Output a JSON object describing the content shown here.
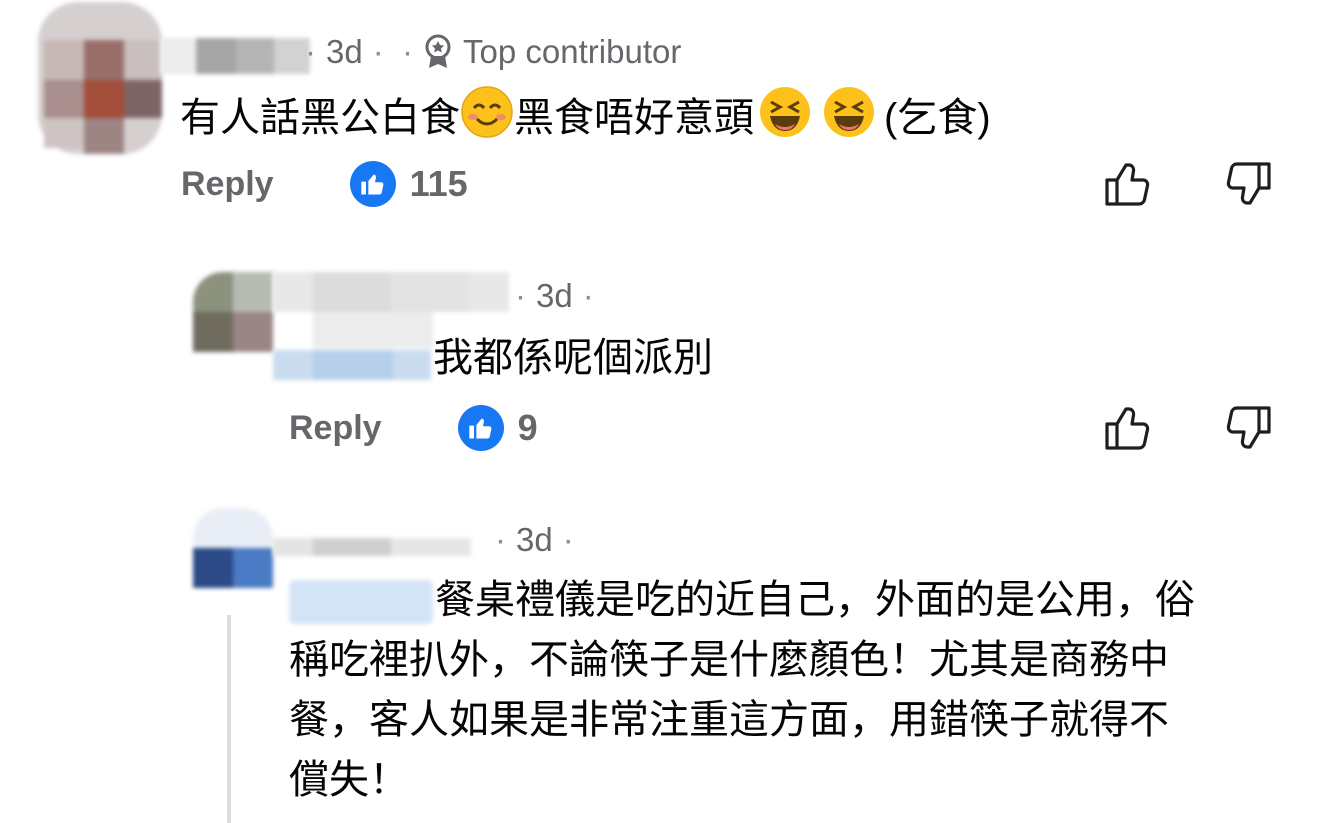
{
  "comments": [
    {
      "time": "3d",
      "badge": "Top contributor",
      "text_parts": [
        "有人話黑公白食",
        "黑食唔好意頭",
        "(乞食)"
      ],
      "reply_label": "Reply",
      "like_count": "115"
    },
    {
      "time": "3d",
      "text": "我都係呢個派別",
      "reply_label": "Reply",
      "like_count": "9"
    },
    {
      "time": "3d",
      "text_lines": [
        "餐桌禮儀是吃的近自己，外面的是公用，俗",
        "稱吃裡扒外，不論筷子是什麼顏色！尤其是商務中",
        "餐，客人如果是非常注重這方面，用錯筷子就得不",
        "償失！"
      ]
    }
  ],
  "colors": {
    "like_blue": "#1877f2",
    "secondary_text": "#65676b"
  },
  "icons": [
    "badge-icon",
    "like-icon",
    "thumbs-up-icon",
    "thumbs-down-icon",
    "smile-emoji",
    "laugh-emoji"
  ]
}
